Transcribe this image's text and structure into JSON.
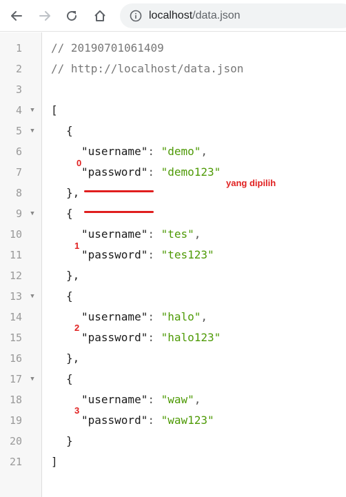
{
  "browser": {
    "url_host": "localhost",
    "url_path": "/data.json"
  },
  "editor": {
    "lines": [
      {
        "n": "1",
        "text": "// 20190701061409"
      },
      {
        "n": "2",
        "text": "// http://localhost/data.json"
      },
      {
        "n": "3",
        "text": ""
      },
      {
        "n": "4",
        "text": "["
      },
      {
        "n": "5",
        "text": "{"
      },
      {
        "n": "6",
        "key": "\"username\"",
        "sep": ": ",
        "val": "\"demo\"",
        "tail": ","
      },
      {
        "n": "7",
        "key": "\"password\"",
        "sep": ": ",
        "val": "\"demo123\"",
        "tail": ""
      },
      {
        "n": "8",
        "text": "},"
      },
      {
        "n": "9",
        "text": "{"
      },
      {
        "n": "10",
        "key": "\"username\"",
        "sep": ": ",
        "val": "\"tes\"",
        "tail": ","
      },
      {
        "n": "11",
        "key": "\"password\"",
        "sep": ": ",
        "val": "\"tes123\"",
        "tail": ""
      },
      {
        "n": "12",
        "text": "},"
      },
      {
        "n": "13",
        "text": "{"
      },
      {
        "n": "14",
        "key": "\"username\"",
        "sep": ": ",
        "val": "\"halo\"",
        "tail": ","
      },
      {
        "n": "15",
        "key": "\"password\"",
        "sep": ": ",
        "val": "\"halo123\"",
        "tail": ""
      },
      {
        "n": "16",
        "text": "},"
      },
      {
        "n": "17",
        "text": "{"
      },
      {
        "n": "18",
        "key": "\"username\"",
        "sep": ": ",
        "val": "\"waw\"",
        "tail": ","
      },
      {
        "n": "19",
        "key": "\"password\"",
        "sep": ": ",
        "val": "\"waw123\"",
        "tail": ""
      },
      {
        "n": "20",
        "text": "}"
      },
      {
        "n": "21",
        "text": "]"
      }
    ],
    "fold_marker": "▼"
  },
  "annotations": {
    "index_0": "0",
    "index_1": "1",
    "index_2": "2",
    "index_3": "3",
    "selected_note": "yang dipilih"
  },
  "colors": {
    "annotation": "#e02020",
    "string": "#4e9a06",
    "comment": "#777777"
  }
}
